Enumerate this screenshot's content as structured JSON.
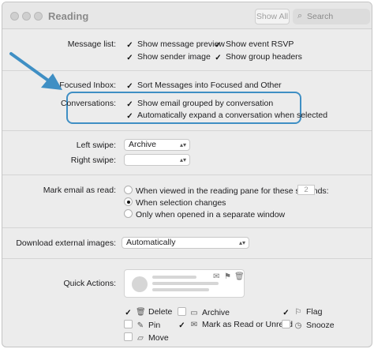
{
  "window": {
    "title": "Reading"
  },
  "toolbar": {
    "show_all": "Show All",
    "search_placeholder": "Search"
  },
  "message_list": {
    "label": "Message list:",
    "options": [
      {
        "label": "Show message preview",
        "checked": true
      },
      {
        "label": "Show event RSVP",
        "checked": true
      },
      {
        "label": "Show sender image",
        "checked": true
      },
      {
        "label": "Show group headers",
        "checked": true
      }
    ]
  },
  "focused_inbox": {
    "label": "Focused Inbox:",
    "option": "Sort Messages into Focused and Other",
    "checked": true
  },
  "conversations": {
    "label": "Conversations:",
    "options": [
      {
        "label": "Show email grouped by conversation",
        "checked": true
      },
      {
        "label": "Automatically expand a conversation when selected",
        "checked": true
      }
    ]
  },
  "swipe": {
    "left_label": "Left swipe:",
    "left_value": "Archive",
    "right_label": "Right swipe:",
    "right_value": ""
  },
  "mark_read": {
    "label": "Mark email as read:",
    "options": [
      {
        "label": "When viewed in the reading pane for these seconds:",
        "selected": false
      },
      {
        "label": "When selection changes",
        "selected": true
      },
      {
        "label": "Only when opened in a separate window",
        "selected": false
      }
    ],
    "seconds": "2"
  },
  "download_images": {
    "label": "Download external images:",
    "value": "Automatically"
  },
  "quick_actions": {
    "label": "Quick Actions:",
    "items": [
      {
        "label": "Delete",
        "icon": "trash-icon",
        "checked": true
      },
      {
        "label": "Archive",
        "icon": "archive-icon",
        "checked": false
      },
      {
        "label": "Flag",
        "icon": "flag-icon",
        "checked": true
      },
      {
        "label": "Pin",
        "icon": "pin-icon",
        "checked": false
      },
      {
        "label": "Mark as Read or Unread",
        "icon": "envelope-icon",
        "checked": true
      },
      {
        "label": "Snooze",
        "icon": "clock-icon",
        "checked": false
      },
      {
        "label": "Move",
        "icon": "folder-icon",
        "checked": false
      }
    ]
  },
  "annotation": {
    "arrow_color": "#3f8fc4",
    "highlight_color": "#3f8fc4"
  }
}
